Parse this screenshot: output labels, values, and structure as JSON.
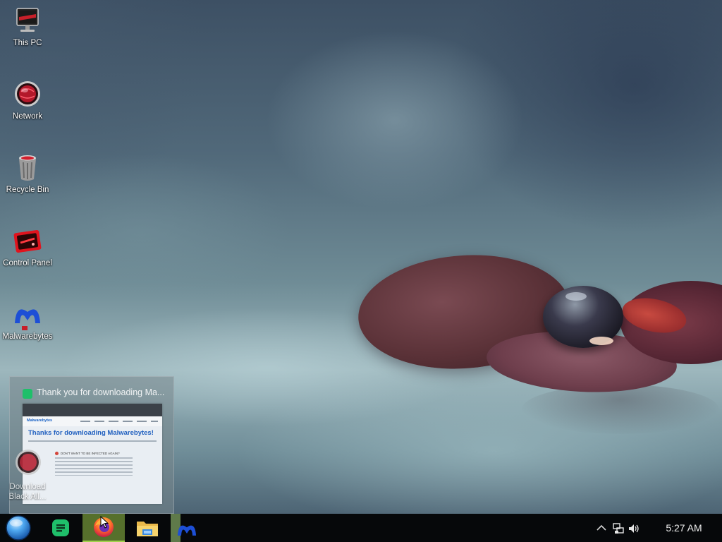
{
  "desktop": {
    "icons": [
      {
        "label": "This PC",
        "icon": "monitor-icon"
      },
      {
        "label": "Network",
        "icon": "network-globe-icon"
      },
      {
        "label": "Recycle Bin",
        "icon": "recycle-bin-icon"
      },
      {
        "label": "Control Panel",
        "icon": "control-panel-icon"
      },
      {
        "label": "Malwarebytes",
        "icon": "malwarebytes-icon"
      }
    ],
    "hidden_icon": {
      "label": "Download Black All...",
      "icon": "network-globe-icon"
    }
  },
  "preview": {
    "title": "Thank you for downloading Ma...",
    "app_icon": "spreadsheet-app-icon",
    "page": {
      "logo": "Malwarebytes",
      "headline": "Thanks for downloading Malwarebytes!",
      "warning": "DON'T WANT TO BE INFECTED AGAIN?"
    }
  },
  "taskbar": {
    "start": "start-orb-icon",
    "pinned": [
      {
        "name": "spreadsheet-app",
        "icon": "spreadsheet-app-icon"
      },
      {
        "name": "firefox",
        "icon": "firefox-icon",
        "active": true
      },
      {
        "name": "file-explorer",
        "icon": "folder-icon"
      },
      {
        "name": "malwarebytes",
        "icon": "malwarebytes-icon"
      }
    ],
    "tray": {
      "clock": "5:27 AM"
    }
  },
  "colors": {
    "taskbar_bg": "#06080a",
    "active_app_bg": "#56702c",
    "active_app_accent": "#9fd14c",
    "spreadsheet_green": "#1fbf6a",
    "malwarebytes_blue": "#1d4fd6"
  }
}
